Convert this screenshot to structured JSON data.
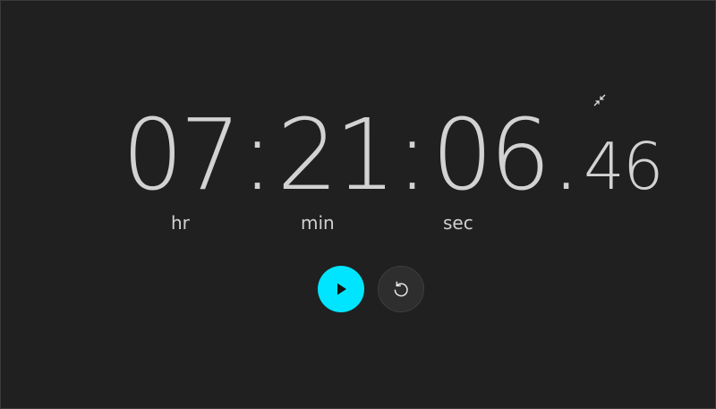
{
  "stopwatch": {
    "hours": "07",
    "minutes": "21",
    "seconds": "06",
    "hundredths": "46",
    "separator": ":",
    "decimal": "."
  },
  "units": {
    "hr": "hr",
    "min": "min",
    "sec": "sec"
  },
  "controls": {
    "play_icon": "play-icon",
    "reset_icon": "reset-icon",
    "compact_icon": "compact-overlay-icon"
  },
  "colors": {
    "accent": "#00e5ff",
    "background": "#202020",
    "text": "#d2d2d2"
  }
}
